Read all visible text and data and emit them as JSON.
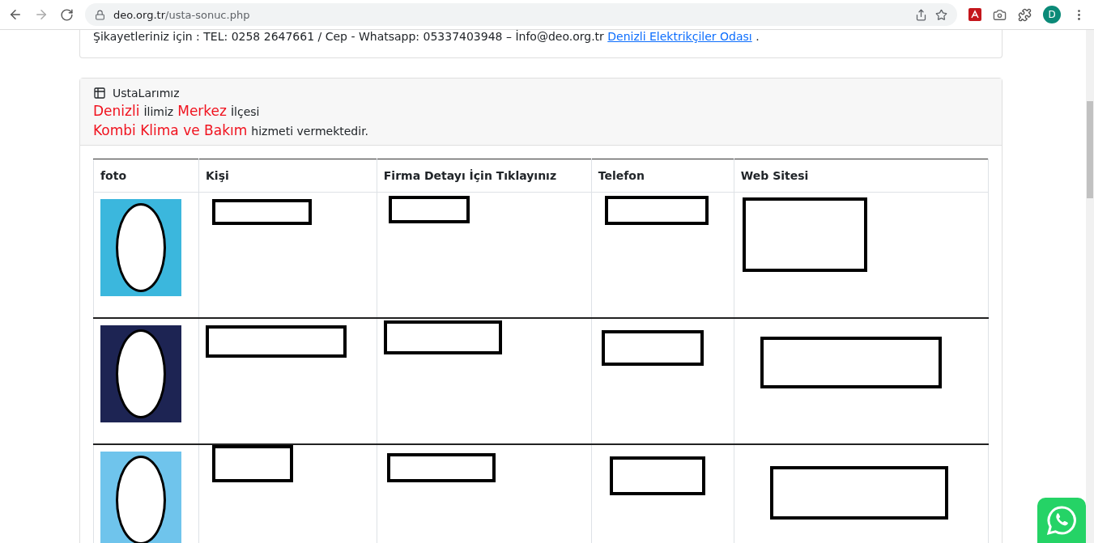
{
  "browser": {
    "url_host": "deo.org.tr",
    "url_path": "/usta-sonuc.php",
    "profile_initial": "D"
  },
  "contact_card": {
    "text": "Şikayetleriniz için : TEL: 0258 2647661 / Cep - Whatsapp: 05337403948 – İnfo@deo.org.tr",
    "link": "Denizli Elektrikçiler Odası",
    "suffix": "."
  },
  "results_card": {
    "title": "UstaLarımız",
    "location_line": [
      {
        "text": "Denizli",
        "highlight": true
      },
      {
        "text": "İlimiz",
        "highlight": false
      },
      {
        "text": "Merkez",
        "highlight": true
      },
      {
        "text": "İlçesi",
        "highlight": false
      }
    ],
    "service_line": [
      {
        "text": "Kombi Klima ve Bakım",
        "highlight": true
      },
      {
        "text": "hizmeti vermektedir.",
        "highlight": false
      }
    ]
  },
  "table": {
    "columns": [
      "foto",
      "Kişi",
      "Firma Detayı İçin Tıklayınız",
      "Telefon",
      "Web Sitesi"
    ],
    "rows": [
      {
        "photo": true,
        "cells": [
          {
            "redacted": true
          },
          {
            "redacted": true
          },
          {
            "redacted": true
          },
          {
            "redacted": true
          }
        ]
      },
      {
        "photo": true,
        "cells": [
          {
            "redacted": true
          },
          {
            "redacted": true
          },
          {
            "redacted": true
          },
          {
            "redacted": true
          }
        ]
      },
      {
        "photo": true,
        "cells": [
          {
            "redacted": true
          },
          {
            "redacted": true
          },
          {
            "redacted": true
          },
          {
            "redacted": true
          }
        ]
      }
    ]
  }
}
